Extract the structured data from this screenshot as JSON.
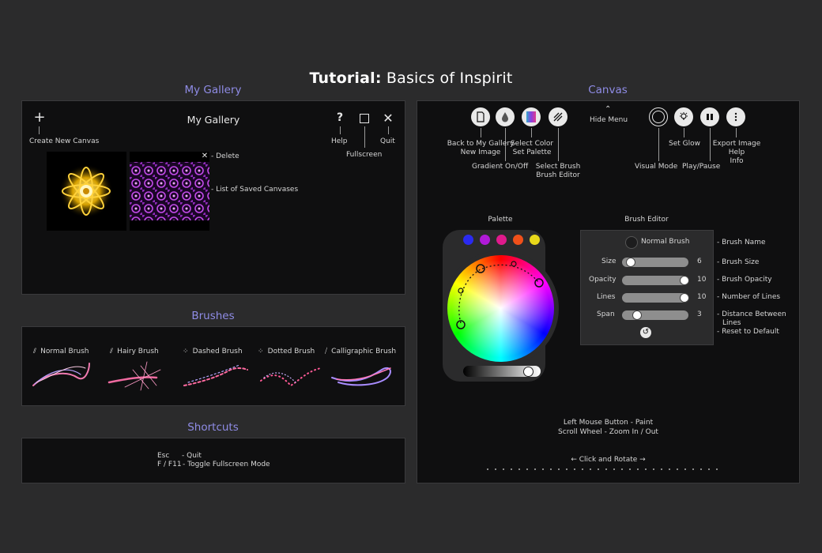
{
  "tutorial_title": {
    "bold": "Tutorial:",
    "rest": " Basics of Inspirit"
  },
  "sections": {
    "gallery": "My Gallery",
    "brushes": "Brushes",
    "shortcuts": "Shortcuts",
    "canvas": "Canvas"
  },
  "gallery": {
    "header": "My Gallery",
    "create_label": "Create New Canvas",
    "help_label": "Help",
    "fullscreen_label": "Fullscreen",
    "quit_label": "Quit",
    "delete_label": "- Delete",
    "saved_label": "- List of Saved Canvases"
  },
  "brushes": [
    {
      "label": "Normal Brush"
    },
    {
      "label": "Hairy Brush"
    },
    {
      "label": "Dashed Brush"
    },
    {
      "label": "Dotted Brush"
    },
    {
      "label": "Calligraphic Brush"
    }
  ],
  "shortcuts": [
    {
      "key": "Esc",
      "desc": "- Quit"
    },
    {
      "key": "F / F11",
      "desc": "- Toggle Fullscreen Mode"
    }
  ],
  "canvas": {
    "hide_menu": "Hide Menu",
    "back_label_1": "Back to My Gallery",
    "back_label_2": "New Image",
    "gradient_label": "Gradient On/Off",
    "select_color_1": "Select Color",
    "select_color_2": "Set Palette",
    "select_brush_1": "Select Brush",
    "select_brush_2": "Brush Editor",
    "visual_mode": "Visual Mode",
    "set_glow": "Set Glow",
    "play_pause": "Play/Pause",
    "export_1": "Export Image",
    "export_2": "Help",
    "export_3": "Info",
    "palette_title": "Palette",
    "palette_colors": [
      "#2a2af0",
      "#b01ad8",
      "#e01a8c",
      "#f0501a",
      "#e8d81a"
    ],
    "brush_editor_title": "Brush Editor",
    "brush_name": "Normal Brush",
    "sliders": [
      {
        "label": "Size",
        "value": "6",
        "level": 0.05
      },
      {
        "label": "Opacity",
        "value": "10",
        "level": 1.0
      },
      {
        "label": "Lines",
        "value": "10",
        "level": 1.0
      },
      {
        "label": "Span",
        "value": "3",
        "level": 0.17
      }
    ],
    "ann_brush_name": "- Brush Name",
    "ann_brush_size": "- Brush Size",
    "ann_brush_opacity": "- Brush Opacity",
    "ann_lines": "- Number of Lines",
    "ann_distance_1": "- Distance Between",
    "ann_distance_2": "Lines",
    "ann_reset": "- Reset to Default",
    "mouse_1": "Left Mouse Button - Paint",
    "mouse_2": "Scroll Wheel - Zoom In / Out",
    "rotate": "← Click and Rotate →"
  }
}
